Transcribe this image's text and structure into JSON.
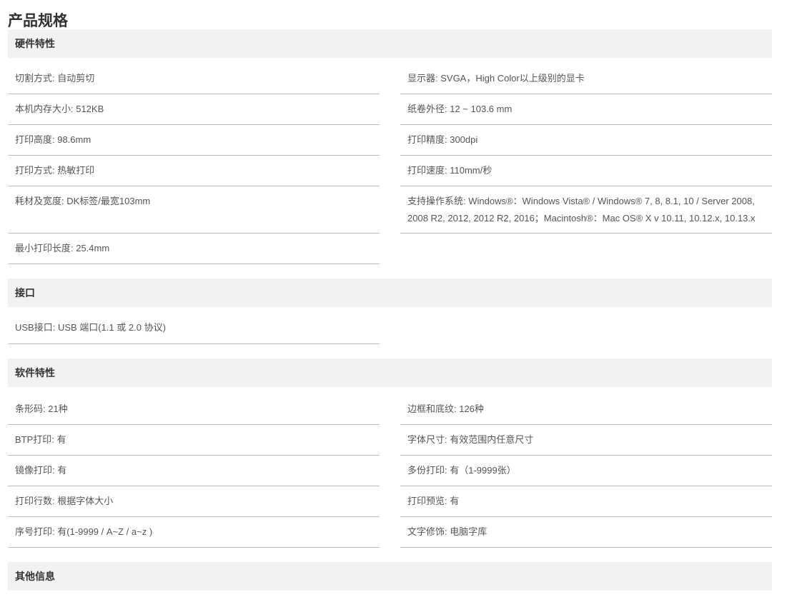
{
  "title": "产品规格",
  "sections": [
    {
      "title": "硬件特性",
      "rows": [
        [
          "切割方式: 自动剪切",
          "显示器: SVGA，High Color以上级别的显卡"
        ],
        [
          "本机内存大小: 512KB",
          "纸卷外径: 12 ~ 103.6 mm"
        ],
        [
          "打印高度: 98.6mm",
          "打印精度: 300dpi"
        ],
        [
          "打印方式: 热敏打印",
          "打印速度: 110mm/秒"
        ],
        [
          "耗材及宽度: DK标签/最宽103mm",
          "支持操作系统: Windows®：Windows Vista® / Windows® 7, 8, 8.1, 10 / Server 2008, 2008 R2, 2012, 2012 R2, 2016；Macintosh®：Mac OS® X v 10.11, 10.12.x, 10.13.x"
        ],
        [
          "最小打印长度: 25.4mm",
          ""
        ]
      ]
    },
    {
      "title": "接口",
      "rows": [
        [
          "USB接口: USB 端口(1.1 或 2.0 协议)",
          ""
        ]
      ]
    },
    {
      "title": "软件特性",
      "rows": [
        [
          "条形码: 21种",
          "边框和底纹: 126种"
        ],
        [
          "BTP打印: 有",
          "字体尺寸: 有效范围内任意尺寸"
        ],
        [
          "镜像打印: 有",
          "多份打印: 有（1-9999张）"
        ],
        [
          "打印行数: 根据字体大小",
          "打印预览: 有"
        ],
        [
          "序号打印: 有(1-9999 / A~Z / a~z )",
          "文字修饰: 电脑字库"
        ]
      ]
    },
    {
      "title": "其他信息",
      "rows": []
    }
  ]
}
